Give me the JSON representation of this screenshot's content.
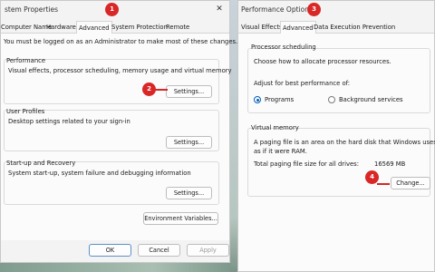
{
  "left_window": {
    "title": "stem Properties",
    "close_glyph": "✕",
    "tabs": [
      "Computer Name",
      "Hardware",
      "Advanced",
      "System Protection",
      "Remote"
    ],
    "admin_notice": "You must be logged on as an Administrator to make most of these changes.",
    "performance": {
      "title": "Performance",
      "description": "Visual effects, processor scheduling, memory usage and virtual memory",
      "button": "Settings..."
    },
    "user_profiles": {
      "title": "User Profiles",
      "description": "Desktop settings related to your sign-in",
      "button": "Settings..."
    },
    "startup_recovery": {
      "title": "Start-up and Recovery",
      "description": "System start-up, system failure and debugging information",
      "button": "Settings..."
    },
    "env_button": "Environment Variables...",
    "ok": "OK",
    "cancel": "Cancel",
    "apply": "Apply"
  },
  "right_window": {
    "title": "Performance Options",
    "tabs": [
      "Visual Effects",
      "Advanced",
      "Data Execution Prevention"
    ],
    "processor_scheduling": {
      "title": "Processor scheduling",
      "description": "Choose how to allocate processor resources.",
      "adjust_label": "Adjust for best performance of:",
      "options": [
        {
          "label": "Programs",
          "checked": true
        },
        {
          "label": "Background services",
          "checked": false
        }
      ]
    },
    "virtual_memory": {
      "title": "Virtual memory",
      "description_line1": "A paging file is an area on the hard disk that Windows uses",
      "description_line2": "as if it were RAM.",
      "total_label": "Total paging file size for all drives:",
      "total_value": "16569 MB",
      "change_button": "Change..."
    }
  },
  "callouts": [
    "1",
    "2",
    "3",
    "4"
  ],
  "colors": {
    "callout": "#d92626",
    "accent": "#005fb8",
    "window_bg": "#f3f3f3"
  }
}
